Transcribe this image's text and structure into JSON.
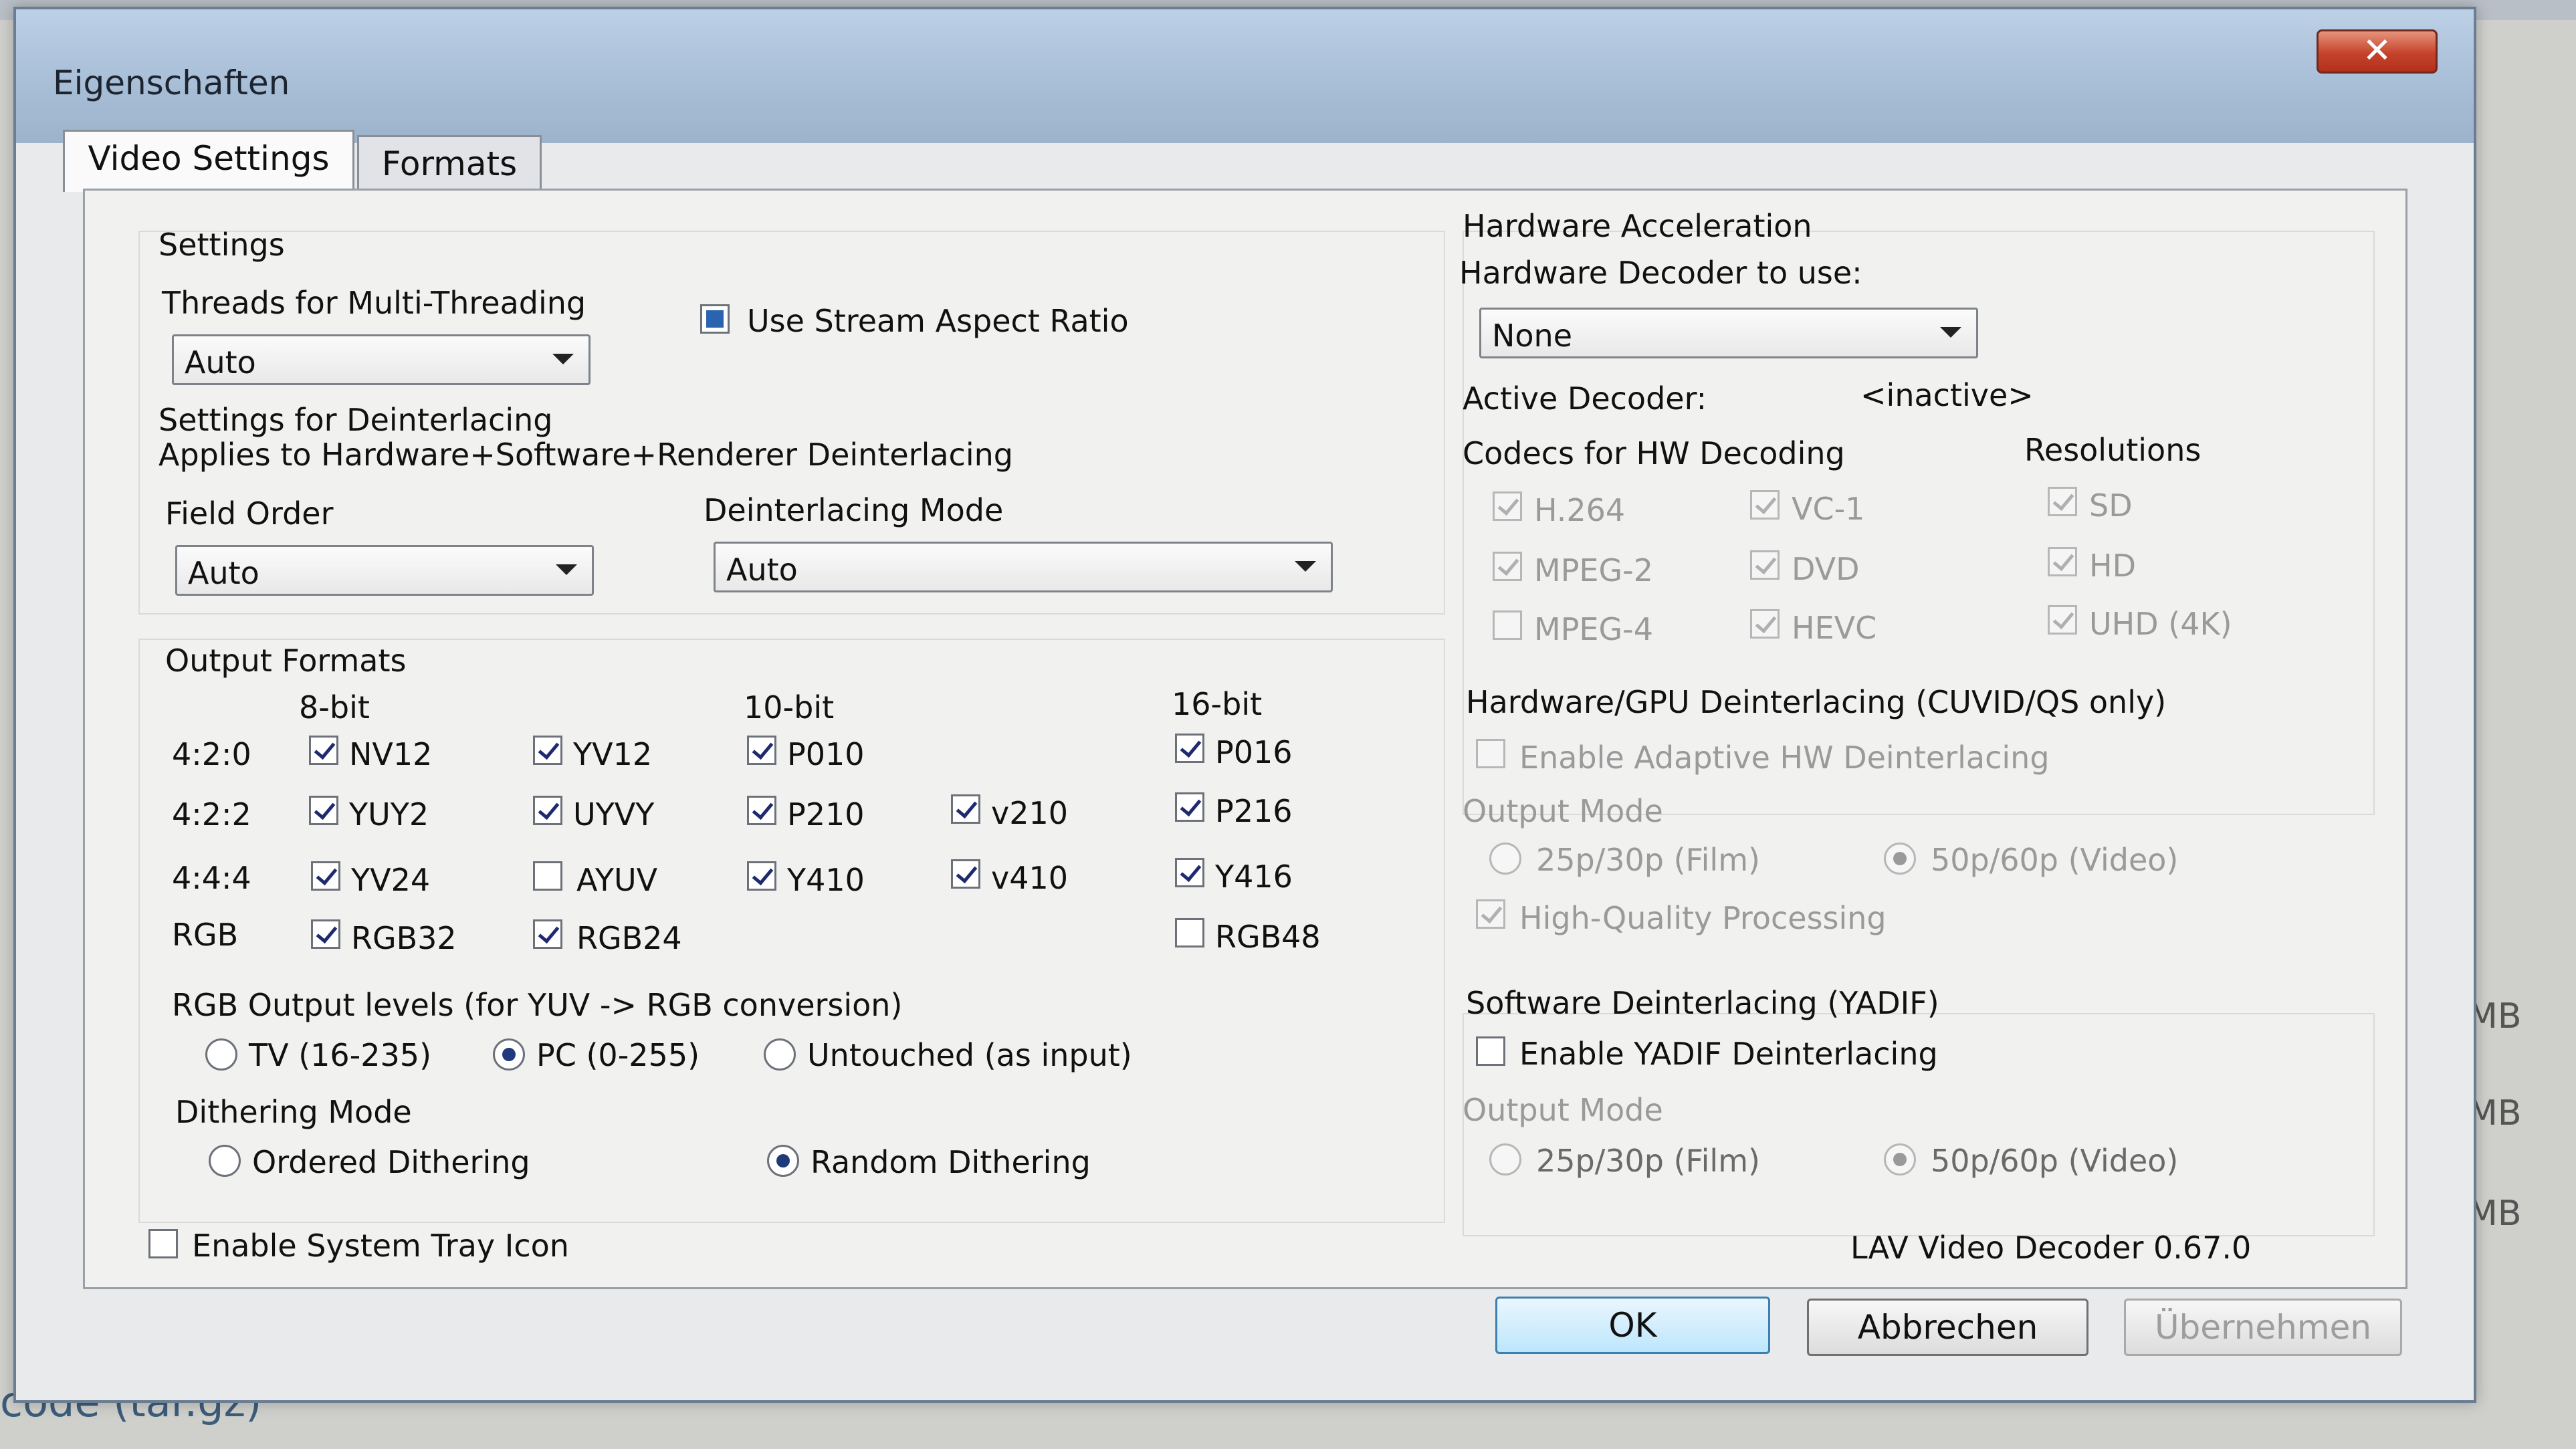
{
  "background": {
    "bottom_text": "code (tar.gz)",
    "mb_labels": [
      "MB",
      "MB",
      "MB"
    ]
  },
  "dialog": {
    "title": "Eigenschaften",
    "close_symbol": "✕",
    "tabs": [
      {
        "label": "Video Settings",
        "active": true
      },
      {
        "label": "Formats",
        "active": false
      }
    ]
  },
  "settings": {
    "heading": "Settings",
    "threads_label": "Threads for Multi-Threading",
    "threads_value": "Auto",
    "stream_aspect_label": "Use Stream Aspect Ratio",
    "deint_heading": "Settings for Deinterlacing",
    "deint_note": "Applies to Hardware+Software+Renderer Deinterlacing",
    "field_order_label": "Field Order",
    "field_order_value": "Auto",
    "deint_mode_label": "Deinterlacing Mode",
    "deint_mode_value": "Auto"
  },
  "output_formats": {
    "heading": "Output Formats",
    "col_8bit": "8-bit",
    "col_10bit": "10-bit",
    "col_16bit": "16-bit",
    "rows": [
      {
        "label": "4:2:0",
        "items": [
          {
            "name": "NV12",
            "checked": true
          },
          {
            "name": "YV12",
            "checked": true
          },
          {
            "name": "P010",
            "checked": true
          },
          {
            "name": "P016",
            "checked": true
          }
        ]
      },
      {
        "label": "4:2:2",
        "items": [
          {
            "name": "YUY2",
            "checked": true
          },
          {
            "name": "UYVY",
            "checked": true
          },
          {
            "name": "P210",
            "checked": true
          },
          {
            "name": "v210",
            "checked": true
          },
          {
            "name": "P216",
            "checked": true
          }
        ]
      },
      {
        "label": "4:4:4",
        "items": [
          {
            "name": "YV24",
            "checked": true
          },
          {
            "name": "AYUV",
            "checked": false
          },
          {
            "name": "Y410",
            "checked": true
          },
          {
            "name": "v410",
            "checked": true
          },
          {
            "name": "Y416",
            "checked": true
          }
        ]
      },
      {
        "label": "RGB",
        "items": [
          {
            "name": "RGB32",
            "checked": true
          },
          {
            "name": "RGB24",
            "checked": true
          },
          {
            "name": "RGB48",
            "checked": false
          }
        ]
      }
    ]
  },
  "rgb_levels": {
    "label": "RGB Output levels (for YUV -> RGB conversion)",
    "options": [
      "TV (16-235)",
      "PC (0-255)",
      "Untouched (as input)"
    ],
    "selected": "PC (0-255)"
  },
  "dithering": {
    "label": "Dithering Mode",
    "options": [
      "Ordered Dithering",
      "Random Dithering"
    ],
    "selected": "Random Dithering"
  },
  "tray_icon_label": "Enable System Tray Icon",
  "version": "LAV Video Decoder 0.67.0",
  "hw_accel": {
    "heading": "Hardware Acceleration",
    "decoder_label": "Hardware Decoder to use:",
    "decoder_value": "None",
    "active_label": "Active Decoder:",
    "active_value": "<inactive>",
    "codecs_label": "Codecs for HW Decoding",
    "resolutions_label": "Resolutions",
    "codecs": [
      {
        "name": "H.264",
        "checked": true
      },
      {
        "name": "VC-1",
        "checked": true
      },
      {
        "name": "MPEG-2",
        "checked": true
      },
      {
        "name": "DVD",
        "checked": true
      },
      {
        "name": "MPEG-4",
        "checked": false
      },
      {
        "name": "HEVC",
        "checked": true
      }
    ],
    "resolutions": [
      {
        "name": "SD",
        "checked": true
      },
      {
        "name": "HD",
        "checked": true
      },
      {
        "name": "UHD (4K)",
        "checked": true
      }
    ]
  },
  "hw_deint": {
    "heading": "Hardware/GPU Deinterlacing (CUVID/QS only)",
    "enable_label": "Enable Adaptive HW Deinterlacing",
    "output_mode_label": "Output Mode",
    "film_label": "25p/30p (Film)",
    "video_label": "50p/60p (Video)",
    "hq_label": "High-Quality Processing"
  },
  "sw_deint": {
    "heading": "Software Deinterlacing (YADIF)",
    "enable_label": "Enable YADIF Deinterlacing",
    "output_mode_label": "Output Mode",
    "film_label": "25p/30p (Film)",
    "video_label": "50p/60p (Video)"
  },
  "buttons": {
    "ok": "OK",
    "cancel": "Abbrechen",
    "apply": "Übernehmen"
  }
}
